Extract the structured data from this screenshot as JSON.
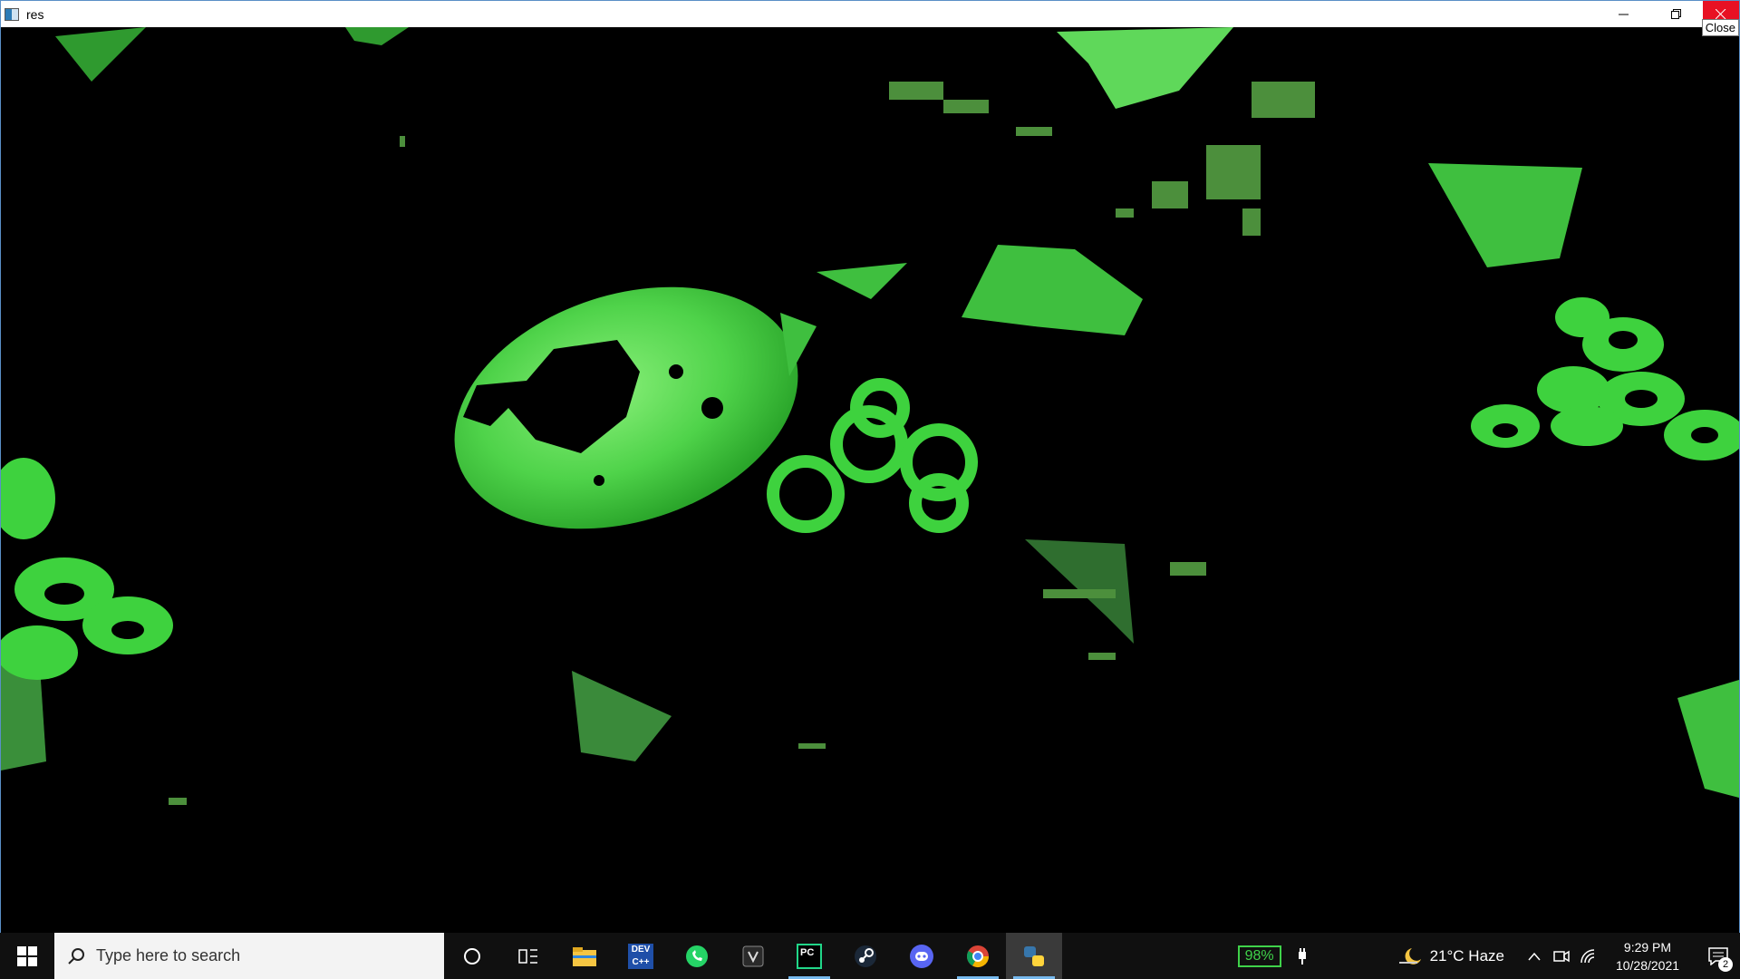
{
  "window": {
    "title": "res",
    "minimize_icon": "minimize-icon",
    "restore_icon": "restore-icon",
    "close_icon": "close-icon",
    "close_tooltip": "Close"
  },
  "taskbar": {
    "search_placeholder": "Type here to search",
    "apps": [
      {
        "name": "cortana-circle-icon"
      },
      {
        "name": "task-view-icon"
      },
      {
        "name": "file-explorer-icon"
      },
      {
        "name": "dev-c-icon",
        "label": "DEV"
      },
      {
        "name": "whatsapp-icon"
      },
      {
        "name": "unknown-app-icon"
      },
      {
        "name": "pycharm-icon",
        "label": "PC"
      },
      {
        "name": "steam-icon"
      },
      {
        "name": "discord-icon"
      },
      {
        "name": "chrome-icon"
      },
      {
        "name": "python-icon"
      }
    ],
    "battery": "98%",
    "weather": "21°C  Haze",
    "time": "9:29 PM",
    "date": "10/28/2021",
    "notifications": "2"
  },
  "colors": {
    "accent_green": "#33dd33",
    "dark_green": "#2a8a2a",
    "close_red": "#e81123"
  }
}
